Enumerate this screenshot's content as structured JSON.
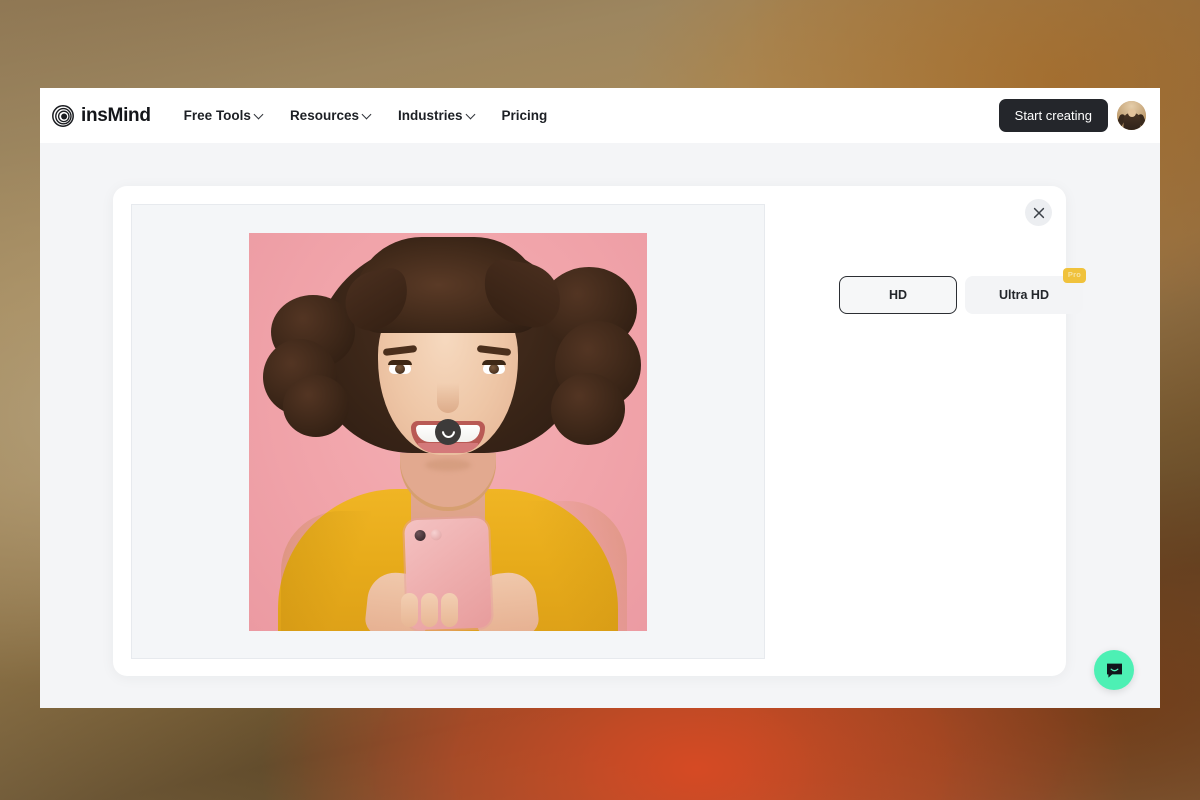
{
  "backdrop": {
    "description": "blurred warm brown and rust photographic gradient",
    "colors": [
      "#8b7352",
      "#ab8d5c",
      "#5f4a2c",
      "#d64a26",
      "#baa884"
    ]
  },
  "header": {
    "logo": {
      "icon": "spiral-logo-icon",
      "text": "insMind"
    },
    "nav": [
      {
        "label": "Free Tools",
        "has_dropdown": true,
        "icon": "chevron-down-icon"
      },
      {
        "label": "Resources",
        "has_dropdown": true,
        "icon": "chevron-down-icon"
      },
      {
        "label": "Industries",
        "has_dropdown": true,
        "icon": "chevron-down-icon"
      },
      {
        "label": "Pricing",
        "has_dropdown": false
      }
    ],
    "cta": {
      "label": "Start creating",
      "bg_color": "#24262b",
      "text_color": "#ffffff"
    },
    "avatar": {
      "icon": "user-avatar",
      "alt": "user profile photo"
    },
    "bg_color": "#ffffff"
  },
  "page": {
    "bg_color": "#f4f5f7"
  },
  "modal": {
    "bg_color": "#ffffff",
    "close": {
      "icon": "close-icon",
      "label": ""
    },
    "preview": {
      "stage_bg": "#f4f6f8",
      "image": {
        "alt": "Smiling woman with short wavy brown hair in a yellow t-shirt holding a pink smartphone on a pink background",
        "bg_color": "#f2a7ad",
        "shirt_color": "#f0b524",
        "phone_color": "#f0b3b3",
        "hair_color": "#3b2618"
      },
      "loading": {
        "icon": "loading-spinner-icon",
        "visible": true
      }
    },
    "quality_options": [
      {
        "label": "HD",
        "selected": true,
        "badge": null
      },
      {
        "label": "Ultra HD",
        "selected": false,
        "badge": "Pro",
        "badge_color": "#f0c23c"
      }
    ]
  },
  "chat_widget": {
    "icon": "chat-bubble-icon",
    "bg_color": "#4df0b4",
    "label": ""
  }
}
